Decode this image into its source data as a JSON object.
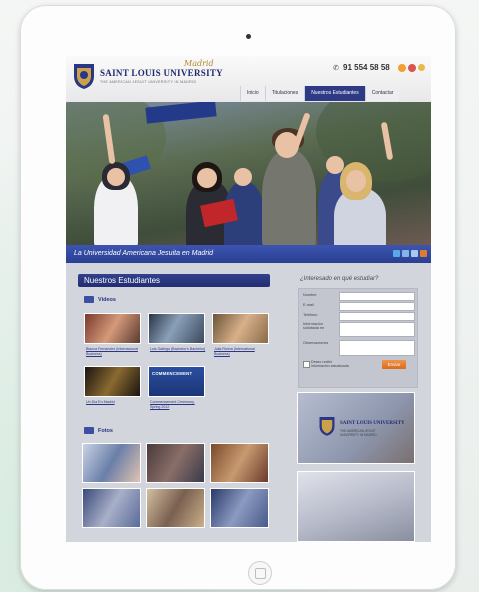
{
  "site": {
    "logo_title": "SAINT LOUIS UNIVERSITY",
    "logo_madrid": "Madrid",
    "logo_sub": "THE AMERICAN JESUIT UNIVERSITY IN MADRID",
    "phone": "91 554 58 58"
  },
  "nav": {
    "items": [
      "Inicio",
      "Titulaciones",
      "Nuestros Estudiantes",
      "Contactar"
    ],
    "active": "Nuestros Estudiantes"
  },
  "hero": {
    "tagline": "La Universidad Americana Jesuita en Madrid"
  },
  "main": {
    "section_title": "Nuestros Estudiantes",
    "videos_label": "Videos",
    "photos_label": "Fotos",
    "commencement_label": "COMMENCEMENT",
    "video_captions": [
      "Blanca Fernandez (Internacional Business)",
      "Luis Gallego (Bachelor's Bachelor)",
      "Julia Rivera (International Business)",
      "Un Día En Madrid",
      "Commencement Ceremony, Spring 2012"
    ]
  },
  "sidebar": {
    "form_title": "¿Interesado en qué estudiar?",
    "fields": [
      "Nombre",
      "E-mail",
      "Teléfono",
      "Información solicitada en",
      "Observaciones"
    ],
    "checkbox_label": "Deseo recibir información actualizada",
    "send_label": "Enviar",
    "slide_title": "SAINT LOUIS UNIVERSITY",
    "slide_sub": "THE AMERICAN JESUIT UNIVERSITY IN MADRID"
  },
  "colors": {
    "navy": "#2e3a86",
    "brand_blue": "#2a3f92",
    "orange": "#e07a2c",
    "gold": "#b58a2a"
  },
  "icons": {
    "phone": "phone-icon",
    "social": [
      "twitter-icon",
      "facebook-icon",
      "youtube-icon"
    ]
  }
}
